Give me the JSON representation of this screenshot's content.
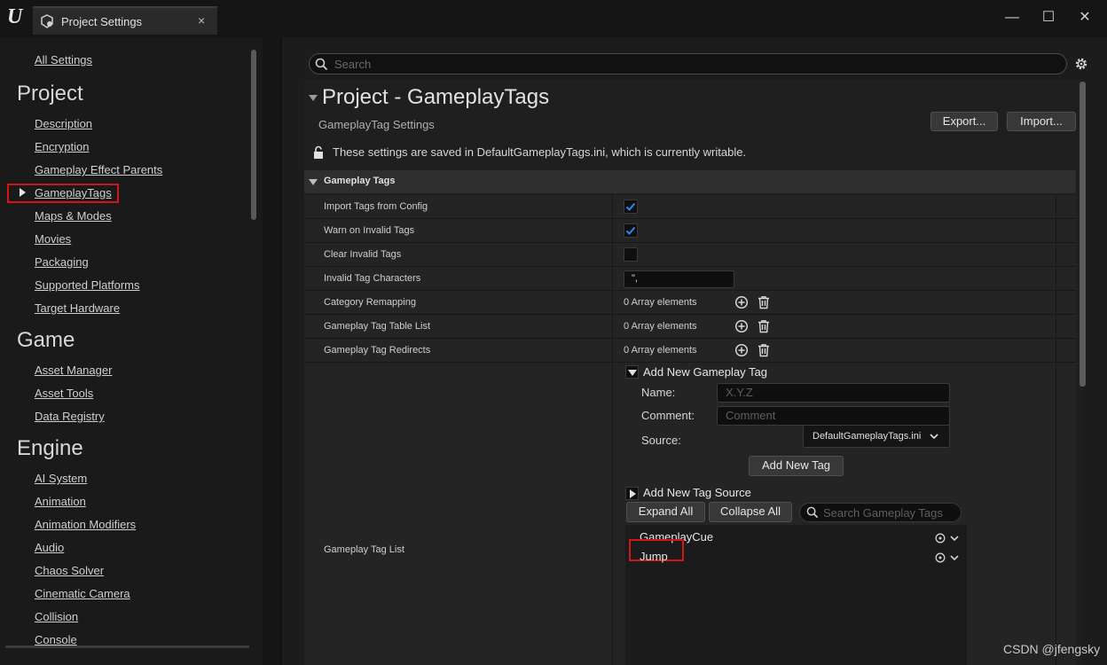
{
  "window": {
    "tab_title": "Project Settings",
    "tab_close": "×",
    "controls": {
      "minimize": "—",
      "maximize": "☐",
      "close": "✕"
    }
  },
  "sidebar": {
    "all_settings": "All Settings",
    "sections": [
      {
        "title": "Project",
        "items": [
          "Description",
          "Encryption",
          "Gameplay Effect Parents",
          "GameplayTags",
          "Maps & Modes",
          "Movies",
          "Packaging",
          "Supported Platforms",
          "Target Hardware"
        ]
      },
      {
        "title": "Game",
        "items": [
          "Asset Manager",
          "Asset Tools",
          "Data Registry"
        ]
      },
      {
        "title": "Engine",
        "items": [
          "AI System",
          "Animation",
          "Animation Modifiers",
          "Audio",
          "Chaos Solver",
          "Cinematic Camera",
          "Collision",
          "Console"
        ]
      }
    ],
    "selected_item": "GameplayTags"
  },
  "search": {
    "placeholder": "Search"
  },
  "header": {
    "title": "Project - GameplayTags",
    "subtitle": "GameplayTag Settings",
    "export_label": "Export...",
    "import_label": "Import...",
    "writable_notice": "These settings are saved in DefaultGameplayTags.ini, which is currently writable."
  },
  "category": {
    "title": "Gameplay Tags",
    "rows": [
      {
        "label": "Import Tags from Config",
        "type": "checkbox",
        "checked": true
      },
      {
        "label": "Warn on Invalid Tags",
        "type": "checkbox",
        "checked": true
      },
      {
        "label": "Clear Invalid Tags",
        "type": "checkbox",
        "checked": false
      },
      {
        "label": "Invalid Tag Characters",
        "type": "text",
        "value": "\",",
        "value_display": "\","
      },
      {
        "label": "Category Remapping",
        "type": "array",
        "value": "0 Array elements"
      },
      {
        "label": "Gameplay Tag Table List",
        "type": "array",
        "value": "0 Array elements"
      },
      {
        "label": "Gameplay Tag Redirects",
        "type": "array",
        "value": "0 Array elements"
      }
    ]
  },
  "tag_list": {
    "label": "Gameplay Tag List",
    "add_new_tag": {
      "title": "Add New Gameplay Tag",
      "name_label": "Name:",
      "name_placeholder": "X.Y.Z",
      "comment_label": "Comment:",
      "comment_placeholder": "Comment",
      "source_label": "Source:",
      "source_value": "DefaultGameplayTags.ini",
      "button": "Add New Tag"
    },
    "add_new_source": "Add New Tag Source",
    "expand_all": "Expand All",
    "collapse_all": "Collapse All",
    "search_placeholder": "Search Gameplay Tags",
    "tags": [
      "GameplayCue",
      "Jump"
    ],
    "highlighted_tag": "Jump"
  },
  "watermark": "CSDN @jfengsky",
  "colors": {
    "highlight": "#d01616",
    "checkmark": "#2f8ae8"
  }
}
